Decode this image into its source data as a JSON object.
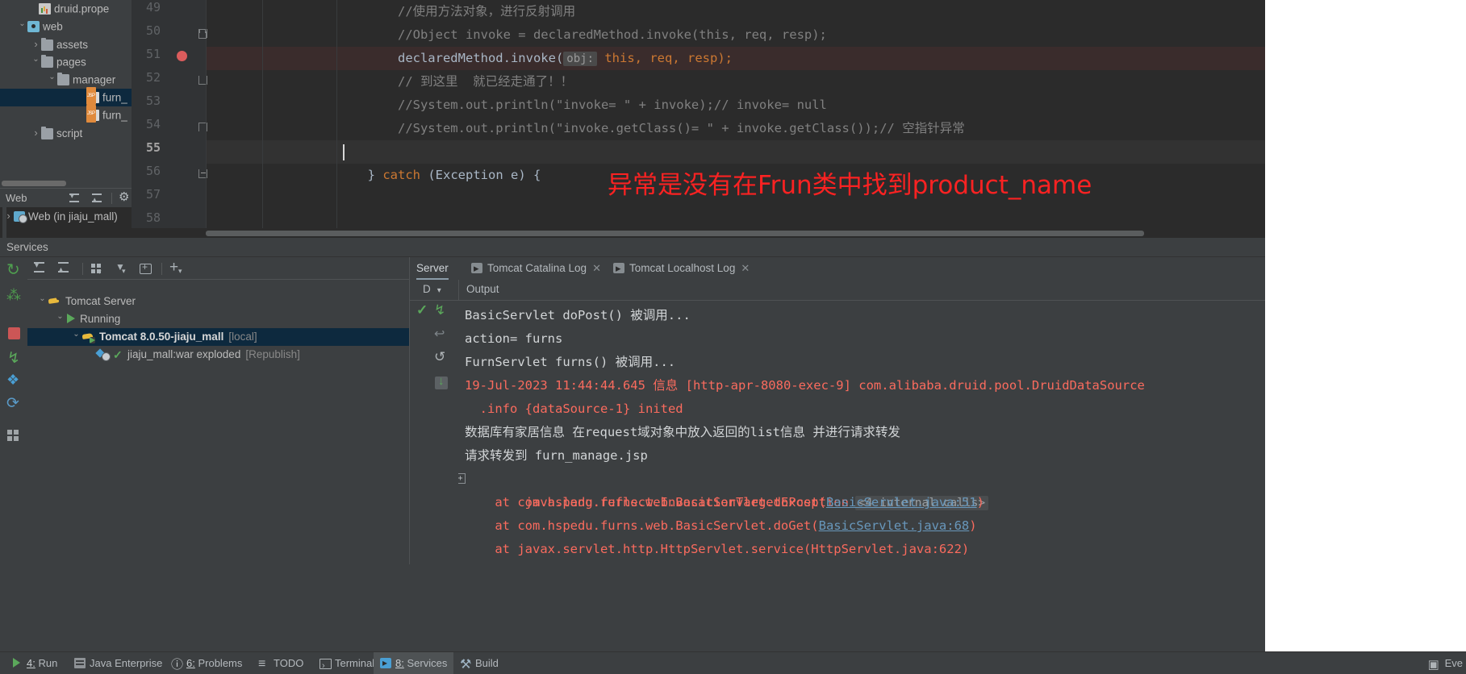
{
  "project_tree": {
    "items": [
      {
        "indent": 3,
        "chevron": "none",
        "icon": "properties-file-icon",
        "label": "druid.prope",
        "selected": false
      },
      {
        "indent": 1,
        "chevron": "open",
        "icon": "web-module-icon",
        "label": "web",
        "selected": false
      },
      {
        "indent": 2,
        "chevron": "closed",
        "icon": "folder-icon",
        "label": "assets",
        "selected": false
      },
      {
        "indent": 2,
        "chevron": "open",
        "icon": "folder-icon",
        "label": "pages",
        "selected": false
      },
      {
        "indent": 3,
        "chevron": "open",
        "icon": "folder-icon",
        "label": "manager",
        "selected": false
      },
      {
        "indent": 5,
        "chevron": "none",
        "icon": "jsp-file-icon",
        "label": "furn_",
        "selected": true
      },
      {
        "indent": 5,
        "chevron": "none",
        "icon": "jsp-file-icon",
        "label": "furn_",
        "selected": false
      },
      {
        "indent": 2,
        "chevron": "closed",
        "icon": "folder-icon",
        "label": "script",
        "selected": false
      }
    ],
    "web_bar": {
      "label": "Web"
    },
    "web_module_row": {
      "label": "Web (in jiaju_mall)"
    }
  },
  "editor": {
    "lines": [
      {
        "num": "49",
        "current": false,
        "segments": [
          {
            "cls": "cmt",
            "text": "            //使用方法对象，进行反射调用"
          }
        ]
      },
      {
        "num": "50",
        "current": false,
        "segments": [
          {
            "cls": "cmt",
            "text": "            //Object invoke = declaredMethod.invoke(this, req, resp);"
          }
        ]
      },
      {
        "num": "51",
        "current": false,
        "highlight": "error",
        "breakpoint": true,
        "segments": [
          {
            "cls": "txt",
            "text": "            declaredMethod.invoke("
          },
          {
            "cls": "hint",
            "text": "obj:"
          },
          {
            "cls": "kw",
            "text": " this"
          },
          {
            "cls": "txt",
            "text": ", req, resp);"
          }
        ]
      },
      {
        "num": "52",
        "current": false,
        "segments": [
          {
            "cls": "cmt",
            "text": "            // 到这里  就已经走通了！！"
          }
        ]
      },
      {
        "num": "53",
        "current": false,
        "segments": [
          {
            "cls": "cmt",
            "text": "            //System.out.println(\"invoke= \" + invoke);// invoke= null"
          }
        ]
      },
      {
        "num": "54",
        "current": false,
        "segments": [
          {
            "cls": "cmt",
            "text": "            //System.out.println(\"invoke.getClass()= \" + invoke.getClass());// 空指针异常"
          }
        ]
      },
      {
        "num": "55",
        "current": true,
        "caret": true,
        "segments": [
          {
            "cls": "txt",
            "text": ""
          }
        ]
      },
      {
        "num": "56",
        "current": false,
        "segments": [
          {
            "cls": "txt",
            "text": "        } "
          },
          {
            "cls": "kw",
            "text": "catch"
          },
          {
            "cls": "txt",
            "text": " (Exception e) {"
          }
        ]
      },
      {
        "num": "57",
        "current": false,
        "segments": [
          {
            "cls": "txt",
            "text": ""
          }
        ]
      },
      {
        "num": "58",
        "current": false,
        "segments": [
          {
            "cls": "txt",
            "text": ""
          }
        ]
      }
    ],
    "annotation": "异常是没有在Frun类中找到product_name",
    "annotation_color": "#fb2222"
  },
  "services": {
    "title": "Services",
    "tree": [
      {
        "indent": 1,
        "chevron": "open",
        "icon": "tomcat-icon",
        "label": "Tomcat Server",
        "suffix": "",
        "selected": false,
        "bold": false
      },
      {
        "indent": 2,
        "chevron": "open",
        "icon": "play-icon",
        "label": "Running",
        "suffix": "",
        "selected": false,
        "bold": false
      },
      {
        "indent": 3,
        "chevron": "open",
        "icon": "tomcat-deploy-icon",
        "label": "Tomcat 8.0.50-jiaju_mall",
        "suffix": "[local]",
        "selected": true,
        "bold": true
      },
      {
        "indent": 4,
        "chevron": "none",
        "icon": "war-icon",
        "label": "jiaju_mall:war exploded",
        "suffix": "[Republish]",
        "selected": false,
        "bold": false
      }
    ],
    "toolbar_icons": [
      "rerun-icon",
      "debug-icon",
      "stop-icon",
      "resume-icon",
      "layout-icon",
      "refresh-icon",
      "grid-icon"
    ],
    "tree_toolbar_icons": [
      "expand-all-icon",
      "collapse-all-icon",
      "group-by-icon",
      "filter-icon",
      "add-tab-icon",
      "add-icon"
    ]
  },
  "console": {
    "tabs": [
      {
        "label": "Server",
        "icon": "",
        "active": true,
        "closable": false
      },
      {
        "label": "Tomcat Catalina Log",
        "icon": "run-tab-icon",
        "active": false,
        "closable": true
      },
      {
        "label": "Tomcat Localhost Log",
        "icon": "run-tab-icon",
        "active": false,
        "closable": true
      }
    ],
    "header": {
      "dropdown": "D",
      "output_label": "Output"
    },
    "gutter_icons": [
      "check-icon",
      "scroll-to-end-icon",
      "soft-wrap-icon",
      "restart-icon",
      "print-icon"
    ],
    "lines": [
      {
        "style": "plain",
        "text": "BasicServlet doPost() 被调用..."
      },
      {
        "style": "plain",
        "text": "action= furns"
      },
      {
        "style": "plain",
        "text": "FurnServlet furns() 被调用..."
      },
      {
        "style": "err",
        "text": "19-Jul-2023 11:44:44.645 信息 [http-apr-8080-exec-9] com.alibaba.druid.pool.DruidDataSource"
      },
      {
        "style": "err",
        "text": "  .info {dataSource-1} inited"
      },
      {
        "style": "plain",
        "text": "数据库有家居信息 在request域对象中放入返回的list信息 并进行请求转发"
      },
      {
        "style": "plain",
        "text": "请求转发到 furn_manage.jsp"
      },
      {
        "style": "err",
        "expander": "+",
        "text": "java.lang.reflect.InvocationTargetException",
        "badge": "<4 internal calls>"
      },
      {
        "style": "err",
        "text": "    at com.hspedu.furns.web.BasicServlet.doPost(",
        "link": "BasicServlet.java:51",
        "tail": ")"
      },
      {
        "style": "err",
        "text": "    at com.hspedu.furns.web.BasicServlet.doGet(",
        "link": "BasicServlet.java:68",
        "tail": ")"
      },
      {
        "style": "err",
        "text": "    at javax.servlet.http.HttpServlet.service(HttpServlet.java:622)"
      }
    ]
  },
  "statusbar": {
    "items": [
      {
        "icon": "run-icon",
        "prefix": "4:",
        "label": "Run",
        "active": false
      },
      {
        "icon": "java-ee-icon",
        "prefix": "",
        "label": "Java Enterprise",
        "active": false
      },
      {
        "icon": "problems-icon",
        "prefix": "6:",
        "label": "Problems",
        "active": false
      },
      {
        "icon": "todo-icon",
        "prefix": "",
        "label": "TODO",
        "active": false
      },
      {
        "icon": "terminal-icon",
        "prefix": "",
        "label": "Terminal",
        "active": false
      },
      {
        "icon": "services-icon",
        "prefix": "8:",
        "label": "Services",
        "active": true
      },
      {
        "icon": "build-icon",
        "prefix": "",
        "label": "Build",
        "active": false
      }
    ],
    "right": {
      "label": "Eve",
      "icon": "event-log-icon"
    }
  }
}
